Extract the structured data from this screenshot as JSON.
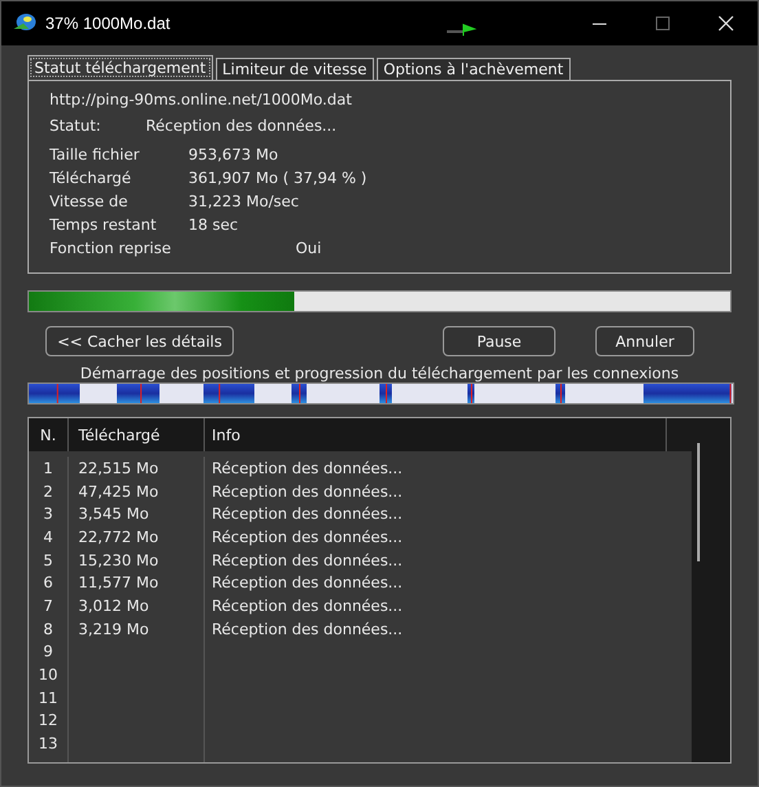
{
  "window": {
    "title": "37% 1000Mo.dat"
  },
  "tabs": [
    {
      "label": "Statut téléchargement",
      "selected": true
    },
    {
      "label": "Limiteur de vitesse",
      "selected": false
    },
    {
      "label": "Options à l'achèvement",
      "selected": false
    }
  ],
  "status": {
    "url": "http://ping-90ms.online.net/1000Mo.dat",
    "status_label": "Statut:",
    "status_value": "Réception des données...",
    "fields": [
      {
        "label": "Taille fichier",
        "value": "953,673  Mo"
      },
      {
        "label": "Téléchargé",
        "value": "361,907  Mo  ( 37,94 % )"
      },
      {
        "label": "Vitesse de",
        "value": "31,223  Mo/sec"
      },
      {
        "label": "Temps restant",
        "value": "18 sec"
      }
    ],
    "resume_label": "Fonction reprise",
    "resume_value": "Oui"
  },
  "progress": {
    "level": 0.3794
  },
  "buttons": {
    "details": "<< Cacher les détails",
    "pause": "Pause",
    "cancel": "Annuler"
  },
  "connections_caption": "Démarrage des positions et progression du téléchargement par les connexions",
  "table": {
    "columns": [
      "N.",
      "Téléchargé",
      "Info"
    ],
    "rows": [
      {
        "n": "1",
        "downloaded": "22,515  Mo",
        "info": "Réception des données..."
      },
      {
        "n": "2",
        "downloaded": "47,425  Mo",
        "info": "Réception des données..."
      },
      {
        "n": "3",
        "downloaded": "3,545  Mo",
        "info": "Réception des données..."
      },
      {
        "n": "4",
        "downloaded": "22,772  Mo",
        "info": "Réception des données..."
      },
      {
        "n": "5",
        "downloaded": "15,230  Mo",
        "info": "Réception des données..."
      },
      {
        "n": "6",
        "downloaded": "11,577  Mo",
        "info": "Réception des données..."
      },
      {
        "n": "7",
        "downloaded": "3,012  Mo",
        "info": "Réception des données..."
      },
      {
        "n": "8",
        "downloaded": "3,219  Mo",
        "info": "Réception des données..."
      },
      {
        "n": "9"
      },
      {
        "n": "10"
      },
      {
        "n": "11"
      },
      {
        "n": "12"
      },
      {
        "n": "13"
      }
    ]
  }
}
